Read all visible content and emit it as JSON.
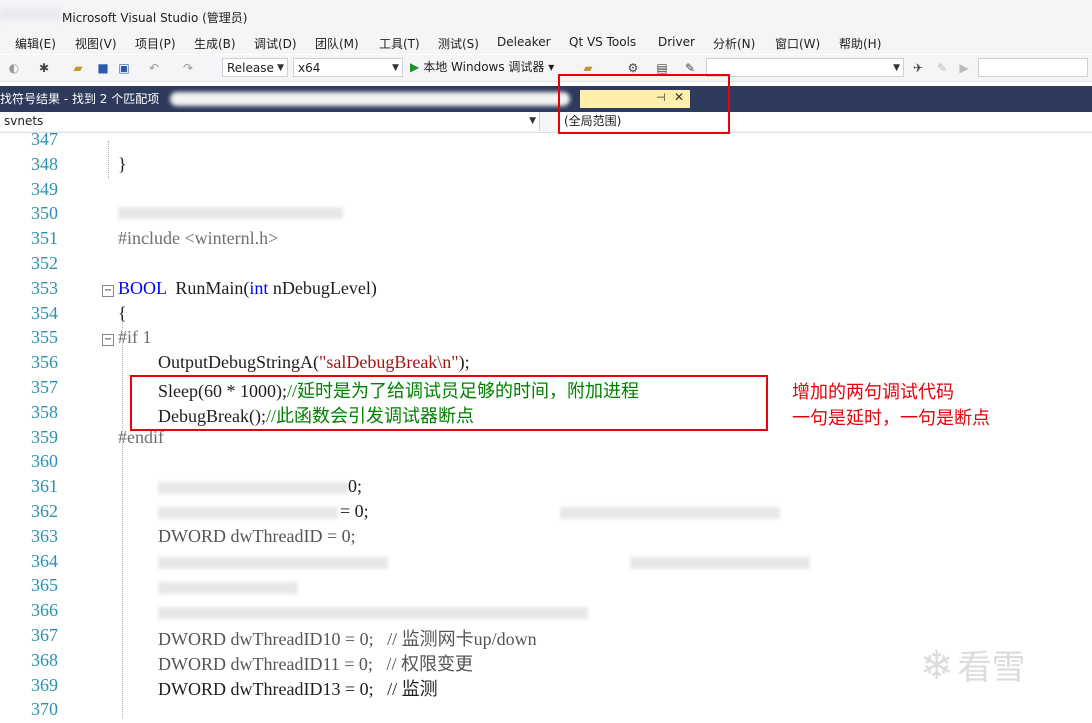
{
  "window": {
    "title": "Microsoft Visual Studio (管理员)"
  },
  "menu": [
    "编辑(E)",
    "视图(V)",
    "项目(P)",
    "生成(B)",
    "调试(D)",
    "团队(M)",
    "工具(T)",
    "测试(S)",
    "Deleaker",
    "Qt VS Tools",
    "Driver",
    "分析(N)",
    "窗口(W)",
    "帮助(H)"
  ],
  "toolbar": {
    "configuration": "Release",
    "platform": "x64",
    "debugger_label": "本地 Windows 调试器"
  },
  "tabs": {
    "find_results": "找符号结果 - 找到 2 个匹配项"
  },
  "navbar": {
    "project": "svnets",
    "scope": "(全局范围)"
  },
  "code": {
    "lines": [
      {
        "n": "347",
        "text": ""
      },
      {
        "n": "348",
        "text": "}"
      },
      {
        "n": "349",
        "text": ""
      },
      {
        "n": "350",
        "text": ""
      },
      {
        "n": "351",
        "text": "#include <winternl.h>"
      },
      {
        "n": "352",
        "text": ""
      },
      {
        "n": "353",
        "text": "BOOL  RunMain(int nDebugLevel)"
      },
      {
        "n": "354",
        "text": "{"
      },
      {
        "n": "355",
        "text": "#if 1"
      },
      {
        "n": "356",
        "text": "OutputDebugStringA(\"salDebugBreak\\n\");"
      },
      {
        "n": "357",
        "text": "Sleep(60 * 1000);//延时是为了给调试员足够的时间，附加进程"
      },
      {
        "n": "358",
        "text": "DebugBreak();//此函数会引发调试器断点"
      },
      {
        "n": "359",
        "text": "#endif"
      },
      {
        "n": "360",
        "text": ""
      },
      {
        "n": "361",
        "text": "0;"
      },
      {
        "n": "362",
        "text": "= 0;"
      },
      {
        "n": "363",
        "text": "DWORD dwThreadID = 0;"
      },
      {
        "n": "364",
        "text": ""
      },
      {
        "n": "365",
        "text": ""
      },
      {
        "n": "366",
        "text": ""
      },
      {
        "n": "367",
        "text": "DWORD dwThreadID10 = 0;   // 监测网卡up/down"
      },
      {
        "n": "368",
        "text": "DWORD dwThreadID11 = 0;   // 权限变更"
      },
      {
        "n": "369",
        "text": "DWORD dwThreadID13 = 0;   // 监测"
      },
      {
        "n": "370",
        "text": ""
      }
    ]
  },
  "annotation": {
    "line1": "增加的两句调试代码",
    "line2": "一句是延时，一句是断点"
  },
  "watermark": "看雪"
}
